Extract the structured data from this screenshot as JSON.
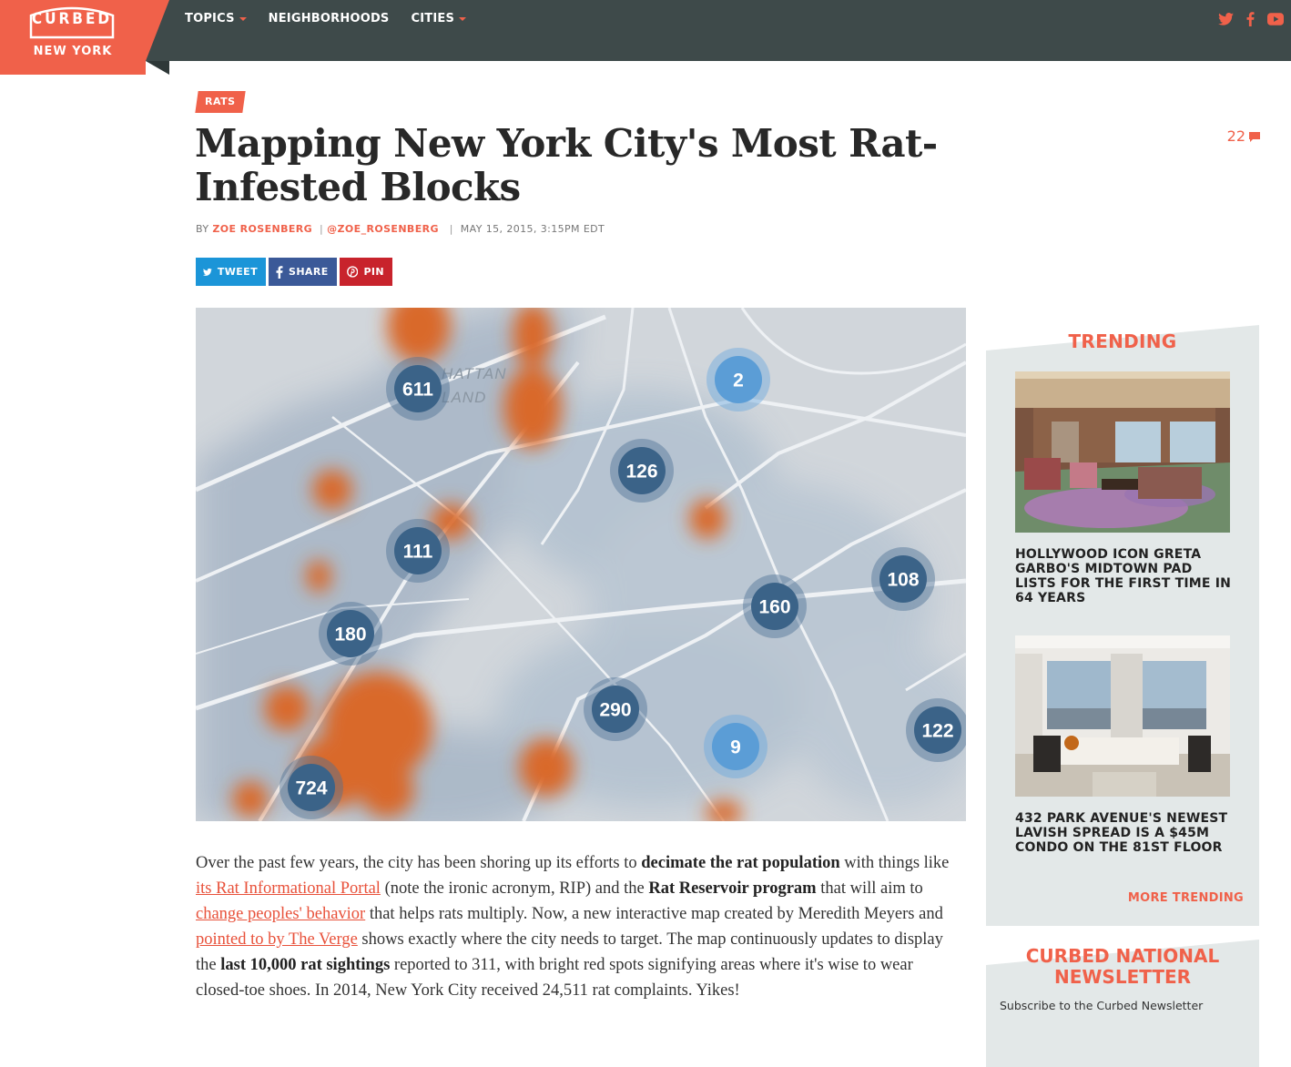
{
  "site": {
    "logo_word": "CURBED",
    "city": "NEW YORK",
    "accent_color": "#f0614a",
    "nav_color": "#3e4a4a"
  },
  "nav": {
    "items": [
      {
        "label": "TOPICS",
        "dropdown": true
      },
      {
        "label": "NEIGHBORHOODS",
        "dropdown": false
      },
      {
        "label": "CITIES",
        "dropdown": true
      }
    ],
    "social": [
      "twitter-icon",
      "facebook-icon",
      "youtube-icon"
    ]
  },
  "article": {
    "tag": "RATS",
    "title": "Mapping New York City's Most Rat-Infested Blocks",
    "comment_count": "22",
    "byline": {
      "prefix": "BY",
      "author": "ZOE ROSENBERG",
      "handle": "@ZOE_ROSENBERG",
      "date": "MAY 15, 2015, 3:15PM EDT"
    },
    "share": {
      "tweet": "TWEET",
      "share": "SHARE",
      "pin": "PIN"
    },
    "map": {
      "place_label_1": "HATTAN",
      "place_label_2": "LAND",
      "clusters": [
        "611",
        "2",
        "126",
        "111",
        "160",
        "108",
        "180",
        "290",
        "9",
        "122",
        "724"
      ]
    },
    "body": {
      "t1": "Over the past few years, the city has been shoring up its efforts to ",
      "b1": "decimate the rat population",
      "t2": " with things like ",
      "l1": "its Rat Informational Portal",
      "t3": " (note the ironic acronym, RIP) and the ",
      "b2": "Rat Reservoir program",
      "t4": " that will aim to ",
      "l2": "change peoples' behavior",
      "t5": " that helps rats multiply. Now, a new interactive map created by Meredith Meyers and ",
      "l3": "pointed to by The Verge",
      "t6": " shows exactly where the city needs to target. The map continuously updates to display the ",
      "b3": "last 10,000 rat sightings",
      "t7": " reported to 311, with bright red spots signifying areas where it's wise to wear closed-toe shoes. In 2014, New York City received 24,511 rat complaints. Yikes!"
    }
  },
  "sidebar": {
    "trending_title": "TRENDING",
    "items": [
      {
        "headline": "HOLLYWOOD ICON GRETA GARBO'S MIDTOWN PAD LISTS FOR THE FIRST TIME IN 64 YEARS"
      },
      {
        "headline": "432 PARK AVENUE'S NEWEST LAVISH SPREAD IS A $45M CONDO ON THE 81ST FLOOR"
      }
    ],
    "more_trending": "MORE TRENDING",
    "newsletter_title": "CURBED NATIONAL NEWSLETTER",
    "newsletter_sub": "Subscribe to the Curbed Newsletter"
  }
}
